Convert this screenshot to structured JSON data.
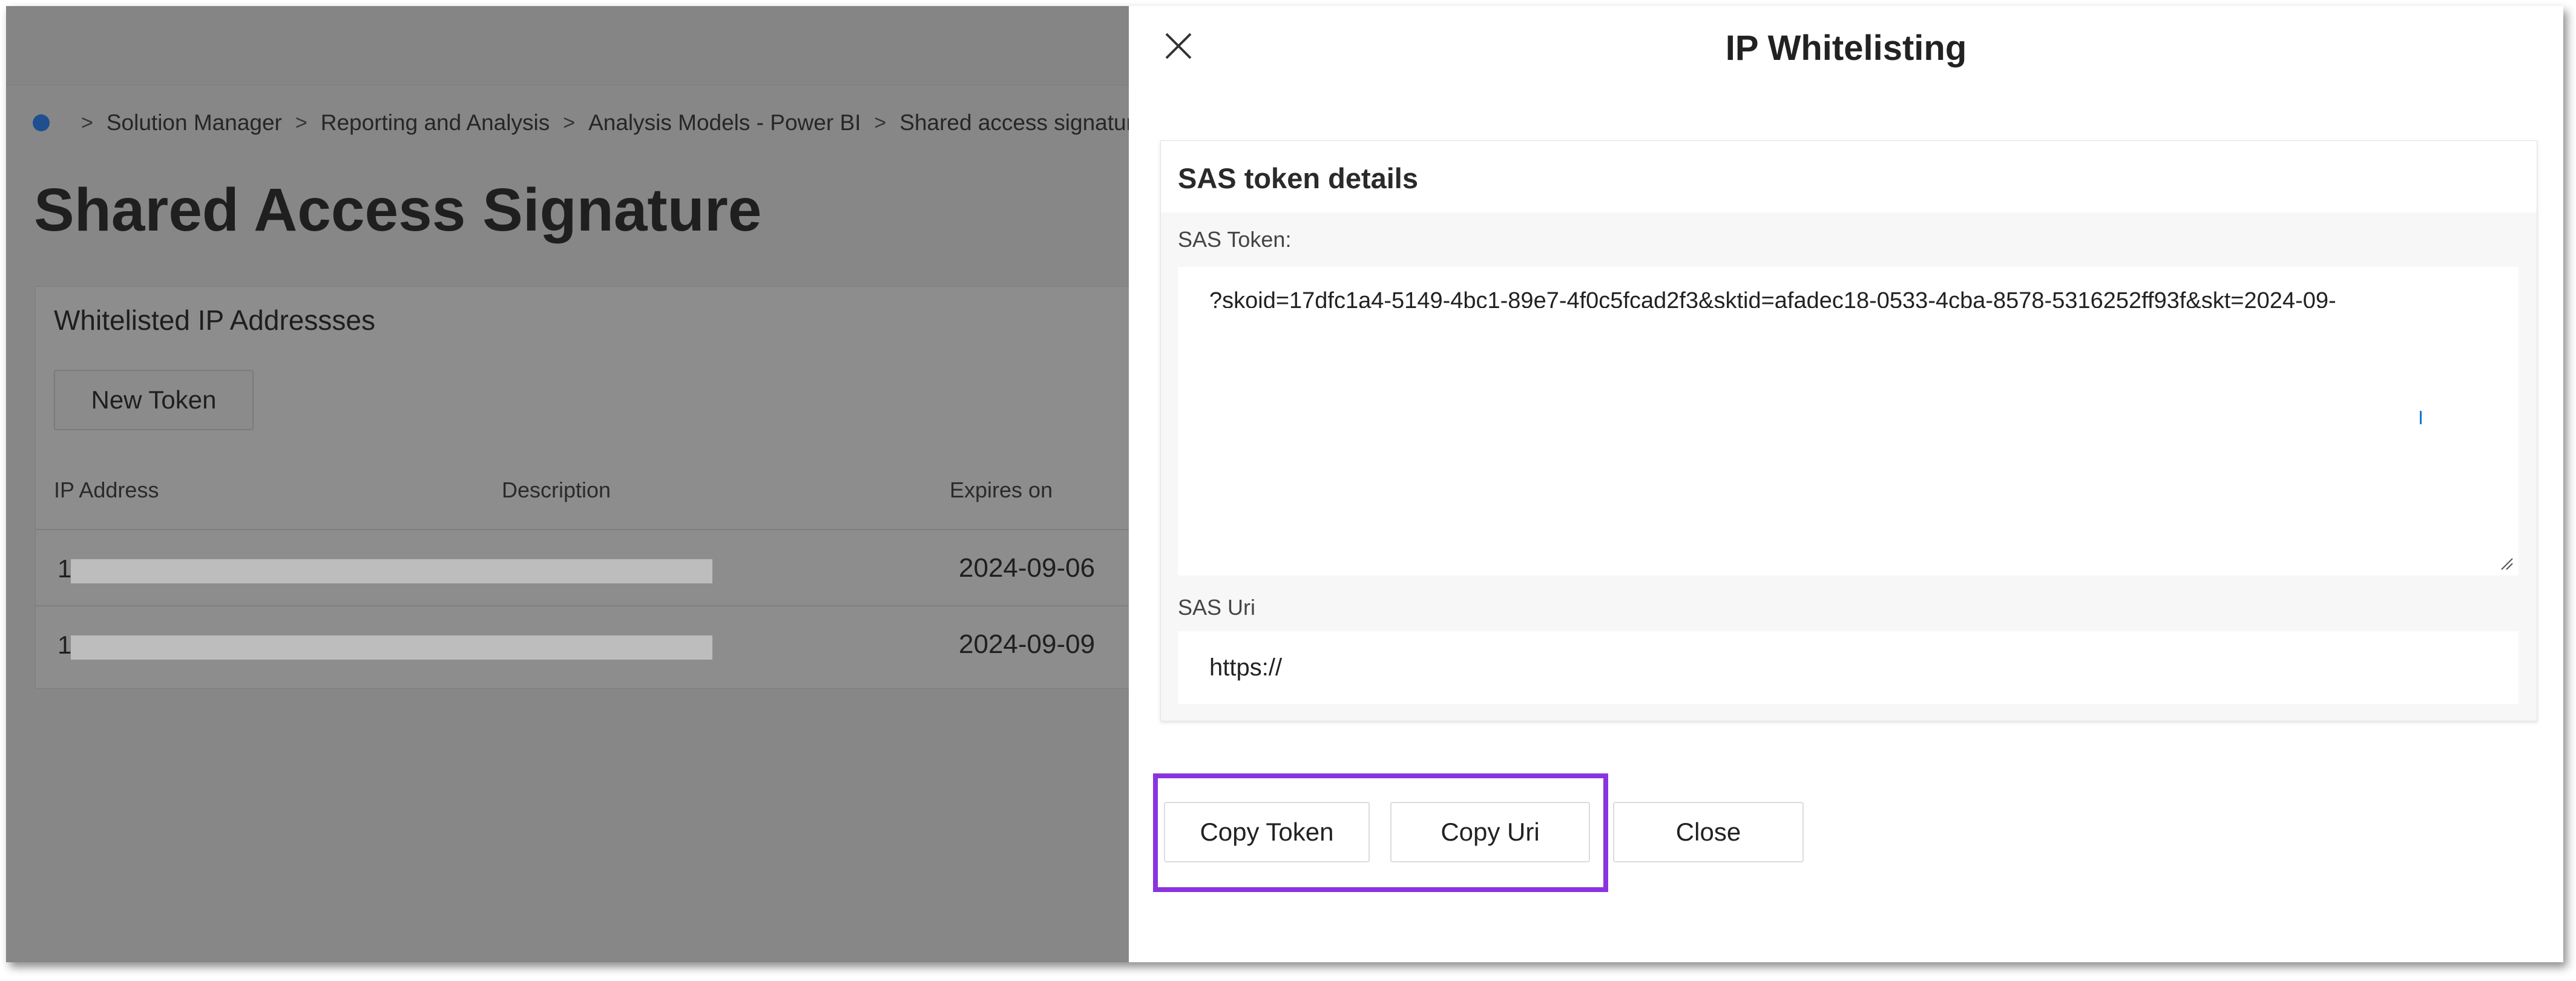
{
  "background": {
    "breadcrumb": [
      "Solution Manager",
      "Reporting and Analysis",
      "Analysis Models - Power BI",
      "Shared access signature"
    ],
    "page_title": "Shared Access Signature",
    "card_title": "Whitelisted IP Addressses",
    "new_token_label": "New Token",
    "columns": [
      "IP Address",
      "Description",
      "Expires on"
    ],
    "rows": [
      {
        "ip": "1",
        "expires": "2024-09-06"
      },
      {
        "ip": "1",
        "expires": "2024-09-09"
      }
    ]
  },
  "drawer": {
    "title": "IP Whitelisting",
    "details_title": "SAS token details",
    "token_label": "SAS Token:",
    "token_value": "?skoid=17dfc1a4-5149-4bc1-89e7-4f0c5fcad2f3&sktid=afadec18-0533-4cba-8578-5316252ff93f&skt=2024-09-",
    "uri_label": "SAS Uri",
    "uri_value": "https://",
    "buttons": {
      "copy_token": "Copy Token",
      "copy_uri": "Copy Uri",
      "close": "Close"
    }
  },
  "colors": {
    "highlight": "#8a34e0",
    "overlay_gray": "#878787",
    "caret_blue": "#1a73c9"
  }
}
